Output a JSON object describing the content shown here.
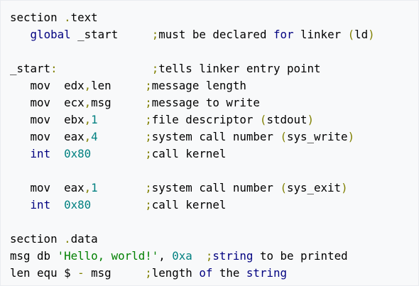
{
  "code": {
    "lines": [
      [
        {
          "t": "section ",
          "c": "plain"
        },
        {
          "t": ".",
          "c": "punct"
        },
        {
          "t": "text",
          "c": "plain"
        }
      ],
      [
        {
          "t": "   ",
          "c": "plain"
        },
        {
          "t": "global",
          "c": "kw"
        },
        {
          "t": " _start     ",
          "c": "plain"
        },
        {
          "t": ";",
          "c": "punct"
        },
        {
          "t": "must be declared ",
          "c": "plain"
        },
        {
          "t": "for",
          "c": "kw"
        },
        {
          "t": " linker ",
          "c": "plain"
        },
        {
          "t": "(",
          "c": "punct"
        },
        {
          "t": "ld",
          "c": "plain"
        },
        {
          "t": ")",
          "c": "punct"
        }
      ],
      [],
      [
        {
          "t": "_start",
          "c": "plain"
        },
        {
          "t": ":",
          "c": "punct"
        },
        {
          "t": "              ",
          "c": "plain"
        },
        {
          "t": ";",
          "c": "punct"
        },
        {
          "t": "tells linker entry point",
          "c": "plain"
        }
      ],
      [
        {
          "t": "   mov  edx",
          "c": "plain"
        },
        {
          "t": ",",
          "c": "punct"
        },
        {
          "t": "len     ",
          "c": "plain"
        },
        {
          "t": ";",
          "c": "punct"
        },
        {
          "t": "message length",
          "c": "plain"
        }
      ],
      [
        {
          "t": "   mov  ecx",
          "c": "plain"
        },
        {
          "t": ",",
          "c": "punct"
        },
        {
          "t": "msg     ",
          "c": "plain"
        },
        {
          "t": ";",
          "c": "punct"
        },
        {
          "t": "message to write",
          "c": "plain"
        }
      ],
      [
        {
          "t": "   mov  ebx",
          "c": "plain"
        },
        {
          "t": ",",
          "c": "punct"
        },
        {
          "t": "1",
          "c": "num"
        },
        {
          "t": "       ",
          "c": "plain"
        },
        {
          "t": ";",
          "c": "punct"
        },
        {
          "t": "file descriptor ",
          "c": "plain"
        },
        {
          "t": "(",
          "c": "punct"
        },
        {
          "t": "stdout",
          "c": "plain"
        },
        {
          "t": ")",
          "c": "punct"
        }
      ],
      [
        {
          "t": "   mov  eax",
          "c": "plain"
        },
        {
          "t": ",",
          "c": "punct"
        },
        {
          "t": "4",
          "c": "num"
        },
        {
          "t": "       ",
          "c": "plain"
        },
        {
          "t": ";",
          "c": "punct"
        },
        {
          "t": "system call number ",
          "c": "plain"
        },
        {
          "t": "(",
          "c": "punct"
        },
        {
          "t": "sys_write",
          "c": "plain"
        },
        {
          "t": ")",
          "c": "punct"
        }
      ],
      [
        {
          "t": "   ",
          "c": "plain"
        },
        {
          "t": "int",
          "c": "kw"
        },
        {
          "t": "  ",
          "c": "plain"
        },
        {
          "t": "0x80",
          "c": "num"
        },
        {
          "t": "        ",
          "c": "plain"
        },
        {
          "t": ";",
          "c": "punct"
        },
        {
          "t": "call kernel",
          "c": "plain"
        }
      ],
      [],
      [
        {
          "t": "   mov  eax",
          "c": "plain"
        },
        {
          "t": ",",
          "c": "punct"
        },
        {
          "t": "1",
          "c": "num"
        },
        {
          "t": "       ",
          "c": "plain"
        },
        {
          "t": ";",
          "c": "punct"
        },
        {
          "t": "system call number ",
          "c": "plain"
        },
        {
          "t": "(",
          "c": "punct"
        },
        {
          "t": "sys_exit",
          "c": "plain"
        },
        {
          "t": ")",
          "c": "punct"
        }
      ],
      [
        {
          "t": "   ",
          "c": "plain"
        },
        {
          "t": "int",
          "c": "kw"
        },
        {
          "t": "  ",
          "c": "plain"
        },
        {
          "t": "0x80",
          "c": "num"
        },
        {
          "t": "        ",
          "c": "plain"
        },
        {
          "t": ";",
          "c": "punct"
        },
        {
          "t": "call kernel",
          "c": "plain"
        }
      ],
      [],
      [
        {
          "t": "section ",
          "c": "plain"
        },
        {
          "t": ".",
          "c": "punct"
        },
        {
          "t": "data",
          "c": "plain"
        }
      ],
      [
        {
          "t": "msg db ",
          "c": "plain"
        },
        {
          "t": "'Hello, world!'",
          "c": "str"
        },
        {
          "t": ", ",
          "c": "plain"
        },
        {
          "t": "0xa",
          "c": "num"
        },
        {
          "t": "  ",
          "c": "plain"
        },
        {
          "t": ";",
          "c": "punct"
        },
        {
          "t": "string",
          "c": "kw"
        },
        {
          "t": " to be printed",
          "c": "plain"
        }
      ],
      [
        {
          "t": "len equ $ ",
          "c": "plain"
        },
        {
          "t": "-",
          "c": "punct"
        },
        {
          "t": " msg     ",
          "c": "plain"
        },
        {
          "t": ";",
          "c": "punct"
        },
        {
          "t": "length ",
          "c": "plain"
        },
        {
          "t": "of",
          "c": "kw"
        },
        {
          "t": " the ",
          "c": "plain"
        },
        {
          "t": "string",
          "c": "kw"
        }
      ]
    ]
  }
}
